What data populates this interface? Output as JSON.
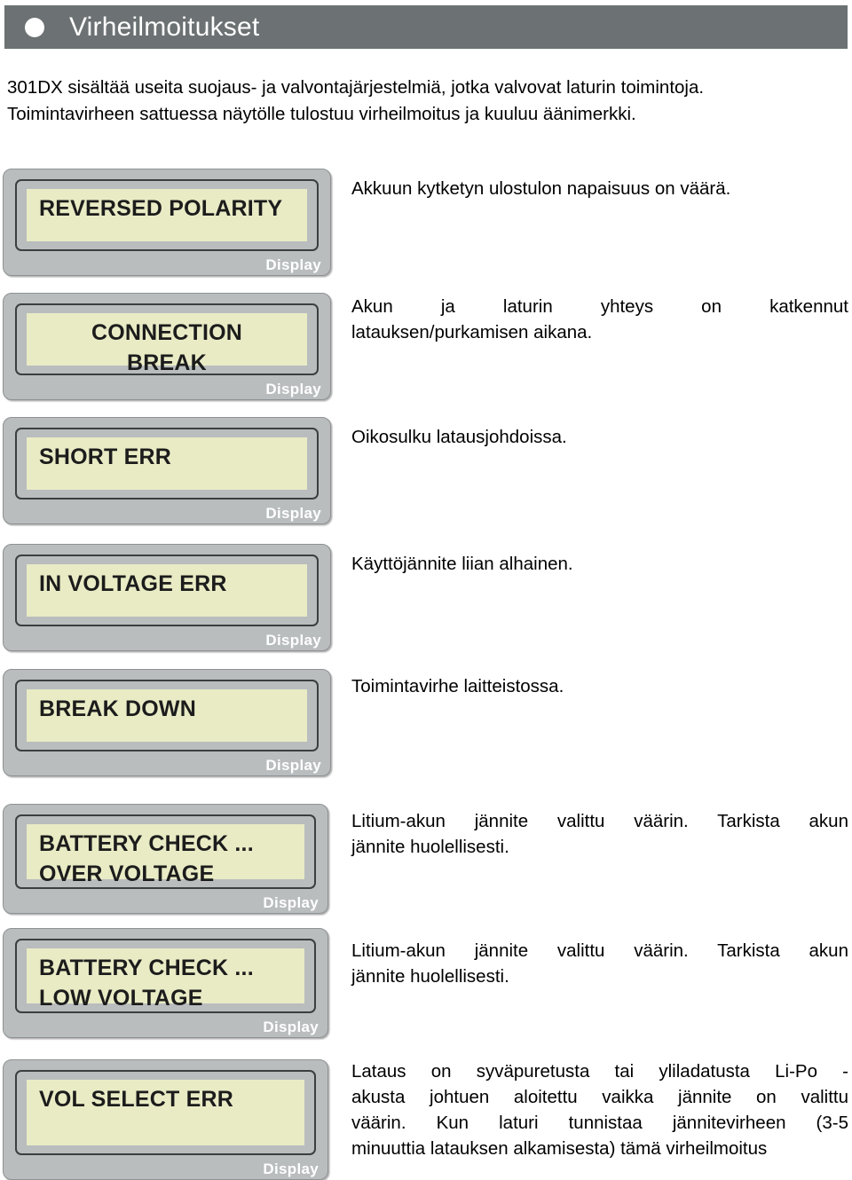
{
  "header": {
    "bullet_icon": "filled-circle-icon",
    "title": "Virheilmoitukset"
  },
  "intro": {
    "line1": "301DX sisältää useita suojaus- ja valvontajärjestelmiä, jotka valvovat laturin toimintoja.",
    "line2": "Toimintavirheen sattuessa näytölle tulostuu virheilmoitus ja kuuluu äänimerkki."
  },
  "display_label": "Display",
  "colors": {
    "header_bg": "#6c7173",
    "panel_bg": "#b9bdbe",
    "panel_inner_border": "#3b3f40",
    "lcd_bg": "#e9ebc5",
    "lcd_text": "#1c1c1c",
    "text": "#000000",
    "page_bg": "#ffffff"
  },
  "error_rows": [
    {
      "id": "reversed-polarity",
      "display_lines": [
        "REVERSED POLARITY"
      ],
      "display_align": "left",
      "description_lines": [
        "Akkuun kytketyn ulostulon napaisuus on väärä."
      ],
      "description_justify": false
    },
    {
      "id": "connection-break",
      "display_lines": [
        "CONNECTION",
        "BREAK"
      ],
      "display_align": "center",
      "description_lines": [
        "Akun ja laturin yhteys on katkennut",
        "latauksen/purkamisen aikana."
      ],
      "description_justify": true
    },
    {
      "id": "short-err",
      "display_lines": [
        "SHORT ERR"
      ],
      "display_align": "left",
      "description_lines": [
        "Oikosulku latausjohdoissa."
      ],
      "description_justify": false
    },
    {
      "id": "in-voltage-err",
      "display_lines": [
        "IN VOLTAGE ERR"
      ],
      "display_align": "left",
      "description_lines": [
        "Käyttöjännite liian alhainen."
      ],
      "description_justify": false
    },
    {
      "id": "break-down",
      "display_lines": [
        "BREAK DOWN"
      ],
      "display_align": "left",
      "description_lines": [
        "Toimintavirhe laitteistossa."
      ],
      "description_justify": false
    },
    {
      "id": "battery-check-over-voltage",
      "display_lines": [
        "BATTERY CHECK ...",
        "OVER VOLTAGE"
      ],
      "display_align": "left",
      "description_lines": [
        "Litium-akun jännite valittu väärin. Tarkista akun",
        "jännite huolellisesti."
      ],
      "description_justify": true
    },
    {
      "id": "battery-check-low-voltage",
      "display_lines": [
        "BATTERY CHECK ...",
        "LOW VOLTAGE"
      ],
      "display_align": "left",
      "description_lines": [
        "Litium-akun jännite valittu väärin. Tarkista akun",
        "jännite huolellisesti."
      ],
      "description_justify": true
    },
    {
      "id": "vol-select-err",
      "display_lines": [
        "VOL SELECT ERR"
      ],
      "display_align": "left",
      "description_lines": [
        "Lataus on syväpuretusta tai yliladatusta Li-Po -",
        "akusta johtuen aloitettu vaikka jännite on valittu",
        "väärin. Kun laturi tunnistaa jännitevirheen (3-5",
        "minuuttia latauksen alkamisesta) tämä virheilmoitus"
      ],
      "description_justify": true
    }
  ]
}
